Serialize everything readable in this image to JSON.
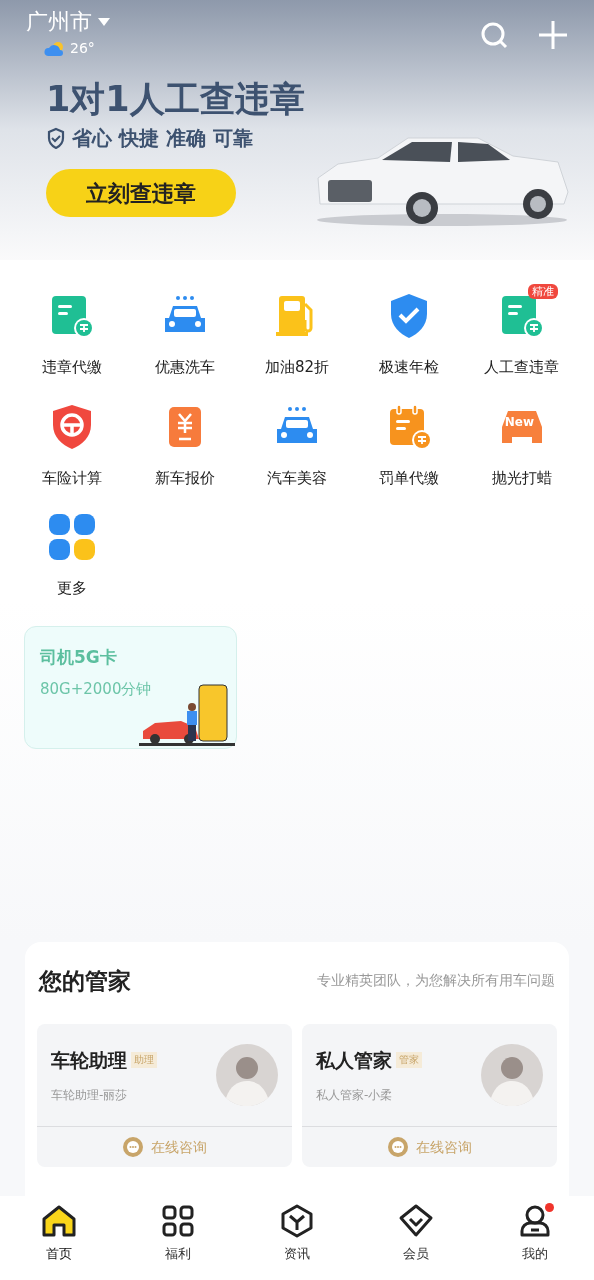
{
  "header": {
    "city": "广州市",
    "temperature": "26°"
  },
  "banner": {
    "title": "1对1人工查违章",
    "tagline": "省心 快捷 准确 可靠",
    "button": "立刻查违章"
  },
  "services": [
    {
      "label": "违章代缴",
      "kind": "bill-green"
    },
    {
      "label": "优惠洗车",
      "kind": "car-wash"
    },
    {
      "label": "加油82折",
      "kind": "fuel"
    },
    {
      "label": "极速年检",
      "kind": "shield-check"
    },
    {
      "label": "人工查违章",
      "kind": "bill-search",
      "badge": "精准"
    },
    {
      "label": "车险计算",
      "kind": "wheel-shield"
    },
    {
      "label": "新车报价",
      "kind": "price-doc"
    },
    {
      "label": "汽车美容",
      "kind": "car-wash"
    },
    {
      "label": "罚单代缴",
      "kind": "calendar-bill"
    },
    {
      "label": "抛光打蜡",
      "kind": "new-car",
      "badge": "New"
    },
    {
      "label": "更多",
      "kind": "more"
    }
  ],
  "promo": {
    "title": "司机5G卡",
    "subtitle": "80G+2000分钟"
  },
  "butler": {
    "title": "您的管家",
    "subtitle": "专业精英团队，为您解决所有用车问题",
    "cards": [
      {
        "name": "车轮助理",
        "tag": "助理",
        "role": "车轮助理-丽莎",
        "action": "在线咨询"
      },
      {
        "name": "私人管家",
        "tag": "管家",
        "role": "私人管家-小柔",
        "action": "在线咨询"
      }
    ]
  },
  "tabs": [
    {
      "label": "首页",
      "kind": "home",
      "selected": true,
      "dot": false
    },
    {
      "label": "福利",
      "kind": "grid",
      "selected": false,
      "dot": false
    },
    {
      "label": "资讯",
      "kind": "cube",
      "selected": false,
      "dot": false
    },
    {
      "label": "会员",
      "kind": "diamond",
      "selected": false,
      "dot": false
    },
    {
      "label": "我的",
      "kind": "user",
      "selected": false,
      "dot": true
    }
  ]
}
